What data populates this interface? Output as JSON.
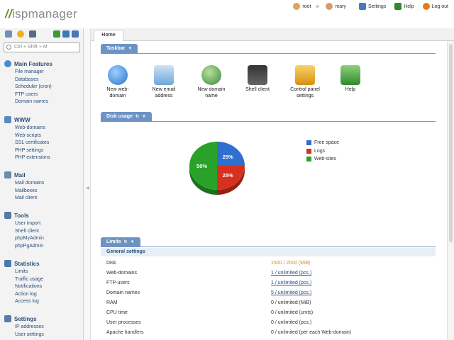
{
  "header": {
    "logo_prefix": "//",
    "logo_text": "ispmanager",
    "user_root": "root",
    "arrow": "»",
    "user_mary": "mary",
    "settings": "Settings",
    "help": "Help",
    "logout": "Log out"
  },
  "sidebar": {
    "search_placeholder": "Ctrl + Shift + M",
    "sections": [
      {
        "title": "Main Features",
        "icon": "globe-icon",
        "items": [
          "File manager",
          "Databases",
          "Scheduler (cron)",
          "FTP users",
          "Domain names"
        ]
      },
      {
        "title": "WWW",
        "icon": "www-icon",
        "items": [
          "Web-domains",
          "Web-scripts",
          "SSL certificates",
          "PHP settings",
          "PHP extensions"
        ]
      },
      {
        "title": "Mail",
        "icon": "mail-icon",
        "items": [
          "Mail domains",
          "Mailboxes",
          "Mail client"
        ]
      },
      {
        "title": "Tools",
        "icon": "tools-icon",
        "items": [
          "User import",
          "Shell client",
          "phpMyAdmin",
          "phpPgAdmin"
        ]
      },
      {
        "title": "Statistics",
        "icon": "statistics-icon",
        "items": [
          "Limits",
          "Traffic usage",
          "Notifications",
          "Action log",
          "Access log"
        ]
      },
      {
        "title": "Settings",
        "icon": "settings-icon",
        "items": [
          "IP addresses",
          "User settings"
        ]
      }
    ]
  },
  "tabs": {
    "home": "Home"
  },
  "taskbar": {
    "title": "Taskbar",
    "items": [
      {
        "label1": "New web-",
        "label2": "domain",
        "icon": "new-web-domain-icon",
        "color": "#3d8fd8"
      },
      {
        "label1": "New email",
        "label2": "address",
        "icon": "new-email-icon",
        "color": "#6ea6d8"
      },
      {
        "label1": "New domain",
        "label2": "name",
        "icon": "new-domain-name-icon",
        "color": "#58a04a"
      },
      {
        "label1": "Shell client",
        "label2": "",
        "icon": "shell-client-icon",
        "color": "#555555"
      },
      {
        "label1": "Control panel",
        "label2": "settings",
        "icon": "control-panel-settings-icon",
        "color": "#e0a21a"
      },
      {
        "label1": "Help",
        "label2": "",
        "icon": "help-icon",
        "color": "#3ea53a"
      }
    ]
  },
  "disk": {
    "title": "Disk usage",
    "legend": [
      {
        "label": "Free space",
        "color": "#2f6fd0"
      },
      {
        "label": "Logs",
        "color": "#d6301e"
      },
      {
        "label": "Web-sites",
        "color": "#2aa22a"
      }
    ],
    "chart_data": {
      "type": "pie",
      "categories": [
        "Free space",
        "Logs",
        "Web-sites"
      ],
      "values": [
        25,
        25,
        50
      ],
      "labels": [
        "25%",
        "25%",
        "50%"
      ]
    }
  },
  "limits": {
    "title": "Limits",
    "group": "General settings",
    "rows": [
      {
        "name": "Disk",
        "value": "1500 / 2000 (MiB)",
        "style": "orange"
      },
      {
        "name": "Web-domains",
        "value": "1 / unlimited (pcs.)",
        "style": "link"
      },
      {
        "name": "FTP-users",
        "value": "1 / unlimited (pcs.)",
        "style": "link"
      },
      {
        "name": "Domain names",
        "value": "5 / unlimited (pcs.)",
        "style": "link"
      },
      {
        "name": "RAM",
        "value": "0 / unlimited (MiB)",
        "style": "plain"
      },
      {
        "name": "CPU time",
        "value": "0 / unlimited (units)",
        "style": "plain"
      },
      {
        "name": "User processes",
        "value": "0 / unlimited (pcs.)",
        "style": "plain"
      },
      {
        "name": "Apache handlers",
        "value": "0 / unlimited (per each Web-domain)",
        "style": "plain"
      }
    ]
  }
}
